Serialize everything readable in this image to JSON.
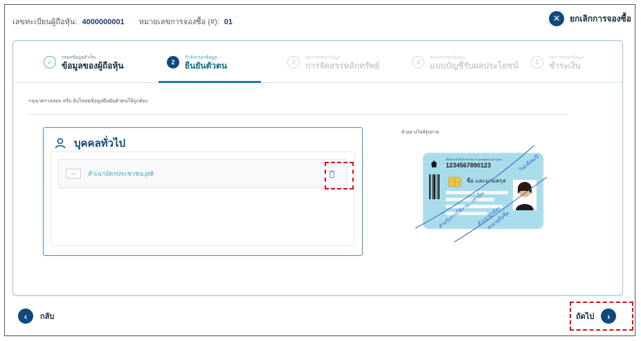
{
  "header": {
    "holder_label": "เลขทะเบียนผู้ถือหุ้น:",
    "holder_value": "4000000001",
    "booking_label": "หมายเลขการจองซื้อ (#):",
    "booking_value": "01",
    "cancel_label": "ยกเลิกการจองซื้อ"
  },
  "steps": [
    {
      "num": "✓",
      "caption": "กรอกข้อมูลสำเร็จ",
      "title": "ข้อมูลของผู้ถือหุ้น",
      "state": "done"
    },
    {
      "num": "2",
      "caption": "กำลังกรอกข้อมูล...",
      "title": "ยืนยันตัวตน",
      "state": "active"
    },
    {
      "num": "3",
      "caption": "รอการกรอกข้อมูล",
      "title": "การจัดสรรหลักทรัพย์",
      "state": "todo"
    },
    {
      "num": "4",
      "caption": "รอการกรอกข้อมูล",
      "title": "แบบบัญชีรับผลประโยชน์",
      "state": "todo"
    },
    {
      "num": "5",
      "caption": "รอการกรอกข้อมูล",
      "title": "ชำระเงิน",
      "state": "todo"
    }
  ],
  "instruction": "กรุณาตรวจสอบ หรือ อัปโหลดข้อมูลยืนยันตัวตนให้ถูกต้อง",
  "person": {
    "title": "บุคคลทั่วไป",
    "file_name": "สำเนาบัตรประชาชน.pdf"
  },
  "sample": {
    "label": "ตัวอย่างไฟล์รูปภาพ",
    "card_header": "บัตรประจำตัวประชาชน Thai National ID Card",
    "card_number": "1234567890123",
    "card_name": "ชื่อ และนามสกุล",
    "stamp1": "สำหรับการใช้งาน...เท่านั้น",
    "stamp2": "สำเนาถูกต้อง",
    "stamp3": "ลงลายมือชื่อ",
    "stamp4": "วัน/เดือน/ปี"
  },
  "footer": {
    "back_label": "กลับ",
    "next_label": "ถัดไป"
  },
  "colors": {
    "accent": "#0f4a7a",
    "highlight": "#d01010",
    "card_blue": "#a9dceb"
  }
}
